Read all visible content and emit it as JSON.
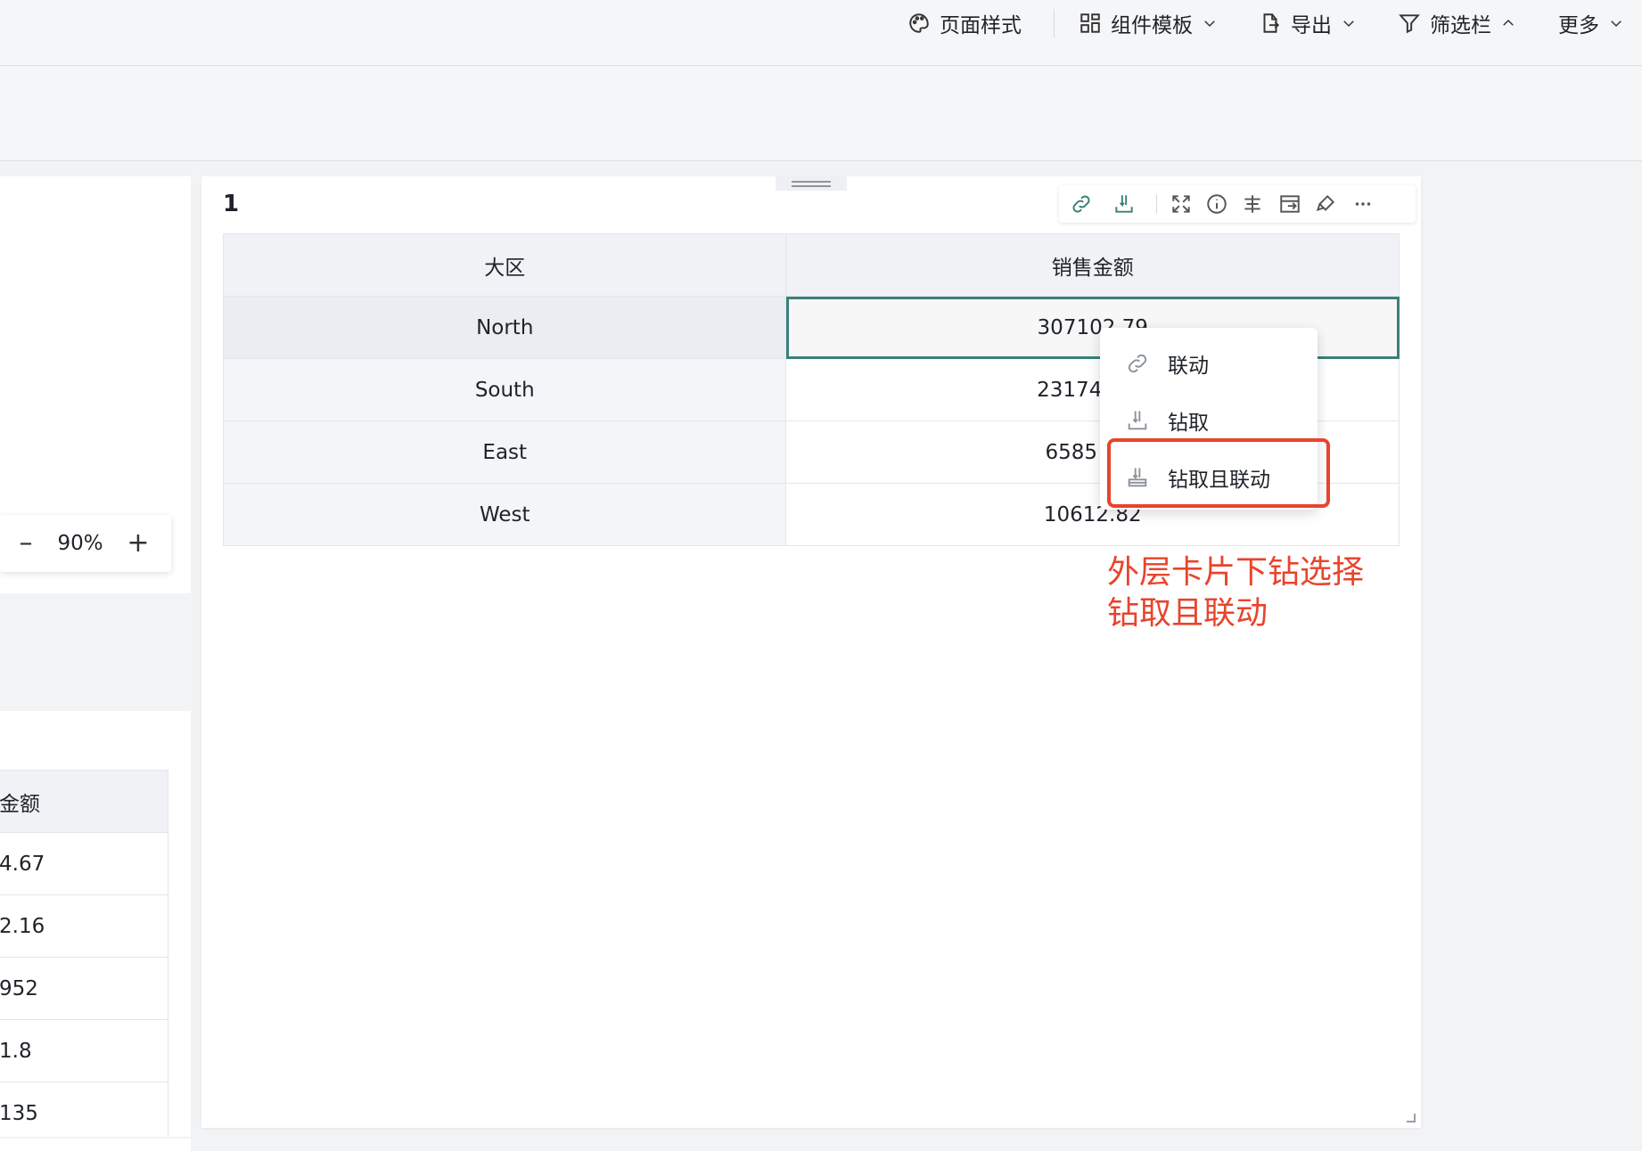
{
  "toolbar": {
    "items": [
      {
        "label": "页面样式",
        "icon": "palette-icon"
      },
      {
        "label": "组件模板",
        "icon": "template-icon"
      },
      {
        "label": "导出",
        "icon": "export-icon"
      },
      {
        "label": "筛选栏",
        "icon": "filter-icon"
      },
      {
        "label": "更多",
        "icon": "chevron-down-icon"
      }
    ]
  },
  "zoom": {
    "value": "90%",
    "minus": "–",
    "plus": "+"
  },
  "left_table": {
    "header": "金额",
    "rows": [
      "4.67",
      "2.16",
      "952",
      "1.8",
      "135"
    ]
  },
  "card": {
    "title": "1",
    "tools": [
      "link-icon",
      "drill-icon",
      "fullscreen-icon",
      "info-icon",
      "align-icon",
      "export-table-icon",
      "paint-icon",
      "more-icon"
    ],
    "columns": [
      "大区",
      "销售金额"
    ],
    "rows": [
      {
        "region": "North",
        "amount": "307102.79"
      },
      {
        "region": "South",
        "amount": "231749.26"
      },
      {
        "region": "East",
        "amount": "65858.14"
      },
      {
        "region": "West",
        "amount": "10612.82"
      }
    ],
    "visible_amounts": [
      "307102.79",
      "23174",
      "6585",
      "10612.82"
    ]
  },
  "context_menu": {
    "items": [
      {
        "label": "联动",
        "icon": "link-icon"
      },
      {
        "label": "钻取",
        "icon": "drill-icon"
      },
      {
        "label": "钻取且联动",
        "icon": "drill-link-icon"
      }
    ]
  },
  "annotation": {
    "line1": "外层卡片下钻选择",
    "line2": "钻取且联动"
  },
  "colors": {
    "accent": "#3a8078",
    "annotation": "#e8442c"
  }
}
